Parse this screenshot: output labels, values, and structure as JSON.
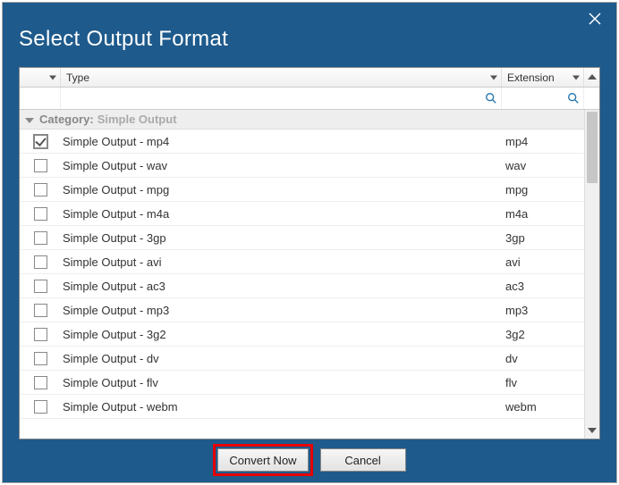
{
  "dialog": {
    "title": "Select Output Format"
  },
  "columns": {
    "type": "Type",
    "ext": "Extension"
  },
  "category": {
    "key": "Category:",
    "value": "Simple Output"
  },
  "rows": [
    {
      "type": "Simple Output - mp4",
      "ext": "mp4",
      "checked": true
    },
    {
      "type": "Simple Output - wav",
      "ext": "wav",
      "checked": false
    },
    {
      "type": "Simple Output - mpg",
      "ext": "mpg",
      "checked": false
    },
    {
      "type": "Simple Output - m4a",
      "ext": "m4a",
      "checked": false
    },
    {
      "type": "Simple Output - 3gp",
      "ext": "3gp",
      "checked": false
    },
    {
      "type": "Simple Output - avi",
      "ext": "avi",
      "checked": false
    },
    {
      "type": "Simple Output - ac3",
      "ext": "ac3",
      "checked": false
    },
    {
      "type": "Simple Output - mp3",
      "ext": "mp3",
      "checked": false
    },
    {
      "type": "Simple Output - 3g2",
      "ext": "3g2",
      "checked": false
    },
    {
      "type": "Simple Output - dv",
      "ext": "dv",
      "checked": false
    },
    {
      "type": "Simple Output - flv",
      "ext": "flv",
      "checked": false
    },
    {
      "type": "Simple Output - webm",
      "ext": "webm",
      "checked": false
    }
  ],
  "buttons": {
    "convert": "Convert Now",
    "cancel": "Cancel"
  },
  "filters": {
    "type_value": "",
    "ext_value": ""
  }
}
